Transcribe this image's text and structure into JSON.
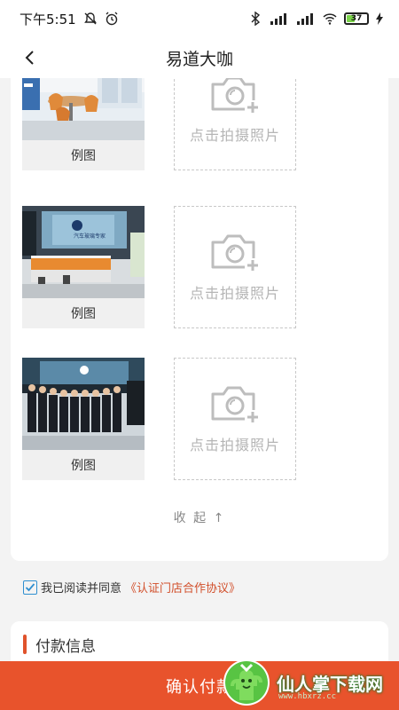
{
  "status_bar": {
    "time": "下午5:51",
    "battery": "37"
  },
  "header": {
    "title": "易道大咖"
  },
  "photos": [
    {
      "example_label": "例图",
      "upload_text": "点击拍摄照片"
    },
    {
      "example_label": "例图",
      "upload_text": "点击拍摄照片"
    },
    {
      "example_label": "例图",
      "upload_text": "点击拍摄照片"
    }
  ],
  "collapse_label": "收 起 ↑",
  "agreement": {
    "text": "我已阅读并同意",
    "link": "《认证门店合作协议》"
  },
  "payment": {
    "title": "付款信息"
  },
  "confirm_label": "确认付款",
  "watermark": {
    "text": "仙人掌下载网",
    "sub": "www.hbxrz.cc"
  },
  "colors": {
    "accent": "#e8532c",
    "checkbox": "#2f8fd0"
  }
}
